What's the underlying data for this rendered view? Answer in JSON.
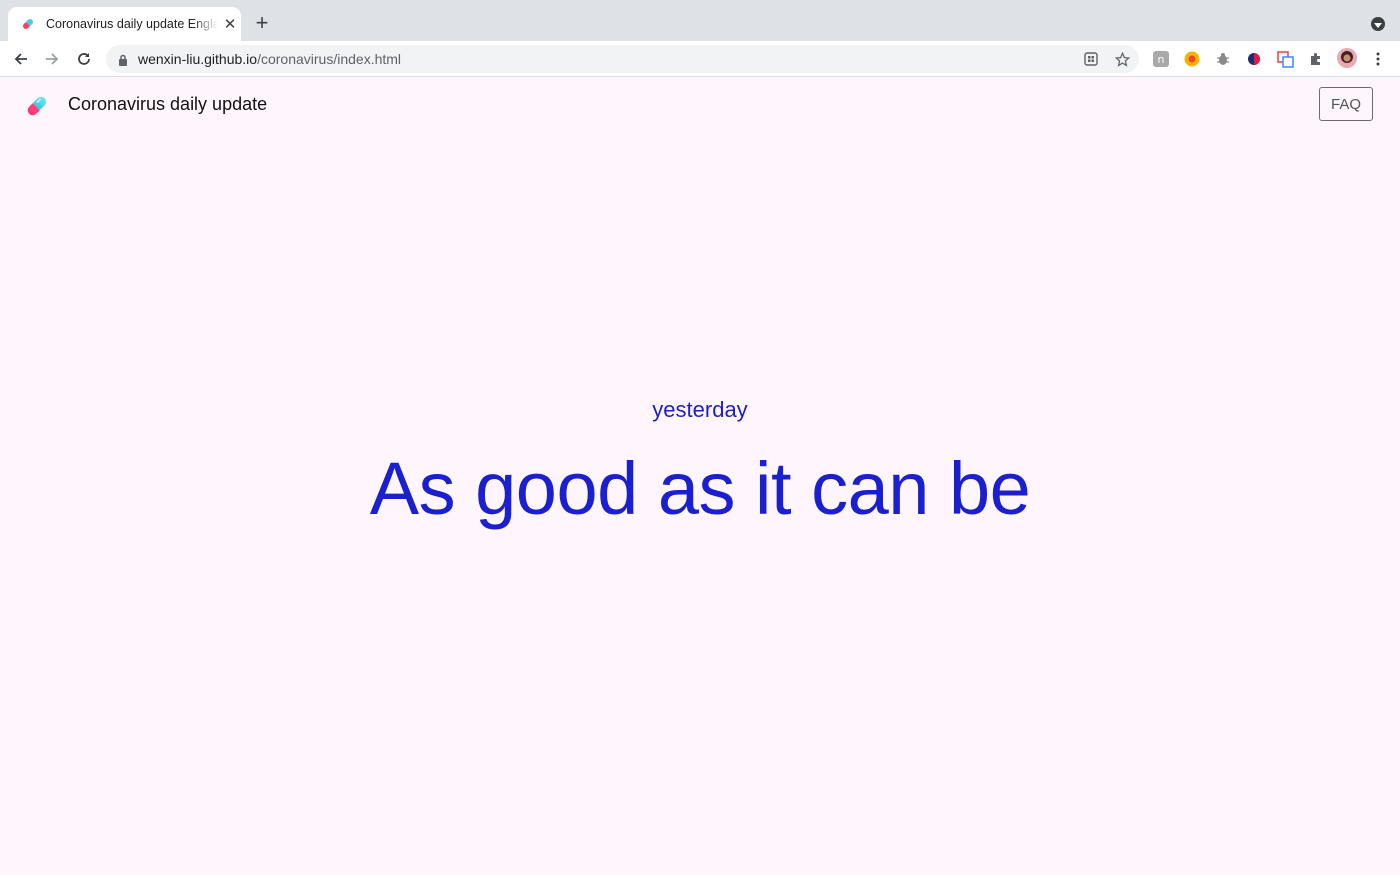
{
  "browser": {
    "tab_title": "Coronavirus daily update England",
    "url_host": "wenxin-liu.github.io",
    "url_path": "/coronavirus/index.html"
  },
  "header": {
    "title": "Coronavirus daily update",
    "faq_label": "FAQ"
  },
  "main": {
    "day_label": "yesterday",
    "status": "As good as it can be"
  },
  "colors": {
    "page_background": "#fff5fc",
    "accent_text": "#1a1fcf",
    "pill_left": "#ff3b6b",
    "pill_right": "#3ccfe6"
  },
  "icons": {
    "favicon": "pill-icon",
    "logo": "pill-icon"
  }
}
